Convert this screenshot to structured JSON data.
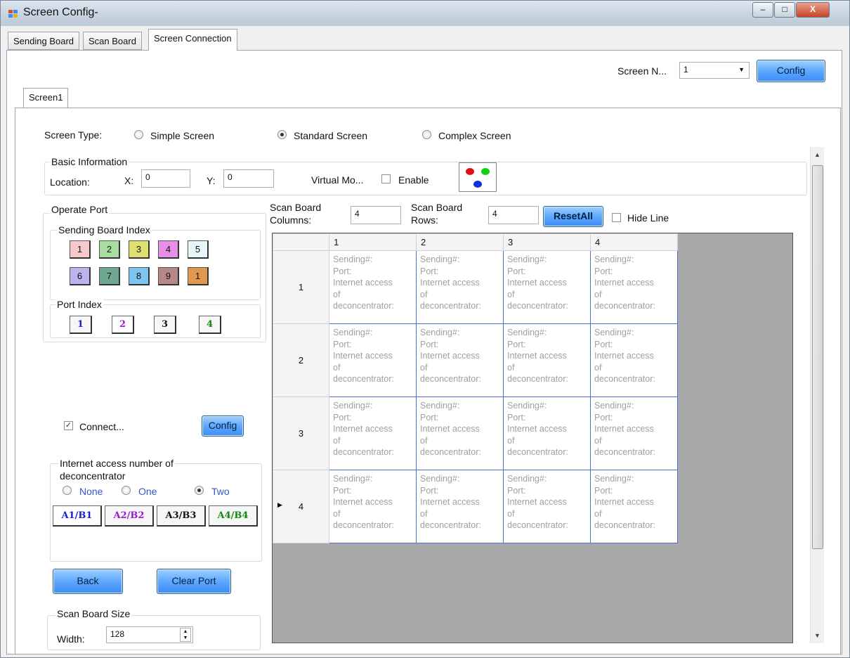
{
  "window": {
    "title": "Screen Config-",
    "buttons": {
      "minimize": "–",
      "maximize": "□",
      "close": "X"
    }
  },
  "tabs": [
    "Sending Board",
    "Scan Board",
    "Screen Connection"
  ],
  "screen_num": {
    "label": "Screen N...",
    "value": "1",
    "config_label": "Config"
  },
  "inner_tab": "Screen1",
  "screen_type": {
    "label": "Screen Type:",
    "options": [
      "Simple Screen",
      "Standard Screen",
      "Complex Screen"
    ],
    "selected": "Standard Screen"
  },
  "basic_info": {
    "title": "Basic Information",
    "location_label": "Location:",
    "x_label": "X:",
    "x_value": "0",
    "y_label": "Y:",
    "y_value": "0",
    "virtual_label": "Virtual Mo...",
    "enable_label": "Enable"
  },
  "operate_port": {
    "title": "Operate Port",
    "sending_board_index_title": "Sending Board Index",
    "sending_board_buttons": [
      {
        "label": "1",
        "color": "#f7c8cc"
      },
      {
        "label": "2",
        "color": "#a8dca0"
      },
      {
        "label": "3",
        "color": "#e0e070"
      },
      {
        "label": "4",
        "color": "#e88ee8"
      },
      {
        "label": "5",
        "color": "#e6f6f8"
      },
      {
        "label": "6",
        "color": "#bcb4ee"
      },
      {
        "label": "7",
        "color": "#6fa890"
      },
      {
        "label": "8",
        "color": "#80c4f0"
      },
      {
        "label": "9",
        "color": "#b88888"
      },
      {
        "label": "1",
        "color": "#e09850"
      }
    ],
    "port_index_title": "Port Index",
    "port_buttons": [
      {
        "label": "1",
        "color": "#1a1ad0"
      },
      {
        "label": "2",
        "color": "#9a1ad0"
      },
      {
        "label": "3",
        "color": "#111111"
      },
      {
        "label": "4",
        "color": "#108a10"
      }
    ],
    "connect_label": "Connect...",
    "connect_checked": true,
    "config_label": "Config"
  },
  "deconcentrator": {
    "title_line1": "Internet access number of",
    "title_line2": "deconcentrator",
    "options": [
      "None",
      "One",
      "Two"
    ],
    "selected": "Two",
    "buttons": [
      {
        "label": "A1/B1",
        "color": "#1a1ad0"
      },
      {
        "label": "A2/B2",
        "color": "#9a1ad0"
      },
      {
        "label": "A3/B3",
        "color": "#111111"
      },
      {
        "label": "A4/B4",
        "color": "#108a10"
      }
    ]
  },
  "actions": {
    "back": "Back",
    "clear_port": "Clear Port"
  },
  "scan_board_size": {
    "title": "Scan Board Size",
    "width_label": "Width:",
    "width_value": "128"
  },
  "scan_board": {
    "columns_label_1": "Scan Board",
    "columns_label_2": "Columns:",
    "columns_value": "4",
    "rows_label_1": "Scan Board",
    "rows_label_2": "Rows:",
    "rows_value": "4",
    "reset_all": "ResetAll",
    "hide_line": "Hide Line"
  },
  "grid": {
    "column_headers": [
      "1",
      "2",
      "3",
      "4"
    ],
    "row_headers": [
      "1",
      "2",
      "3",
      "4"
    ],
    "current_row": "4",
    "cell_lines": [
      "Sending#:",
      "Port:",
      "Internet access",
      "of",
      "deconcentrator:"
    ]
  },
  "colors": {
    "accent_blue": "#3b8cf5",
    "grid_border": "#4a6fd0",
    "grid_background": "#a9a9a9"
  }
}
